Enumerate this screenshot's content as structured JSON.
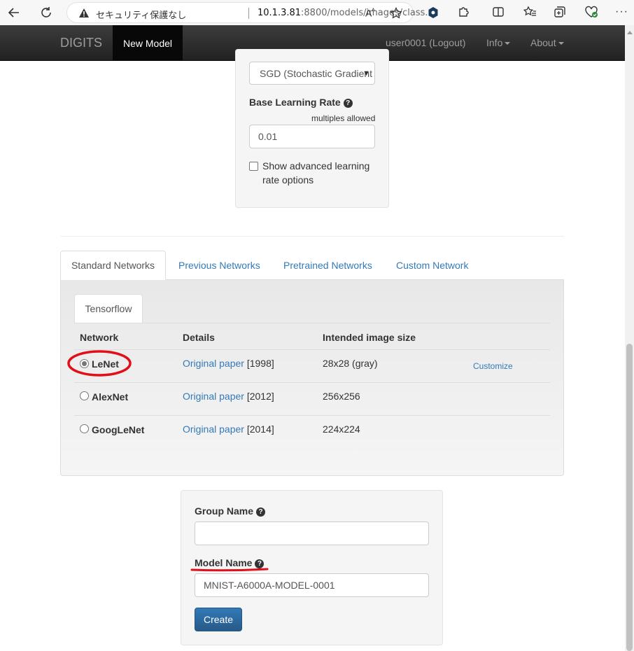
{
  "browser": {
    "security_label": "セキュリティ保護なし",
    "url_host": "10.1.3.81",
    "url_rest": ":8800/models/images/class...",
    "read_aloud": "Aᴬ"
  },
  "navbar": {
    "brand": "DIGITS",
    "active": "New Model",
    "user": "user0001 (Logout)",
    "info": "Info",
    "about": "About"
  },
  "solver": {
    "selected": "SGD (Stochastic Gradient Descent)"
  },
  "learning_rate": {
    "label": "Base Learning Rate",
    "hint": "multiples allowed",
    "value": "0.01",
    "advanced_label": "Show advanced learning",
    "advanced_label2": "rate options"
  },
  "tabs": [
    "Standard Networks",
    "Previous Networks",
    "Pretrained Networks",
    "Custom Network"
  ],
  "framework_tab": "Tensorflow",
  "table": {
    "headers": [
      "Network",
      "Details",
      "Intended image size"
    ],
    "rows": [
      {
        "network": "LeNet",
        "link": "Original paper",
        "year": "[1998]",
        "size": "28x28 (gray)",
        "action": "Customize",
        "selected": true
      },
      {
        "network": "AlexNet",
        "link": "Original paper",
        "year": "[2012]",
        "size": "256x256",
        "action": "",
        "selected": false
      },
      {
        "network": "GoogLeNet",
        "link": "Original paper",
        "year": "[2014]",
        "size": "224x224",
        "action": "",
        "selected": false
      }
    ]
  },
  "form": {
    "group_label": "Group Name",
    "group_value": "",
    "model_label": "Model Name",
    "model_value": "MNIST-A6000A-MODEL-0001",
    "create": "Create"
  },
  "colors": {
    "annotation": "#e0101a",
    "link": "#337ab7",
    "primary": "#286090"
  }
}
